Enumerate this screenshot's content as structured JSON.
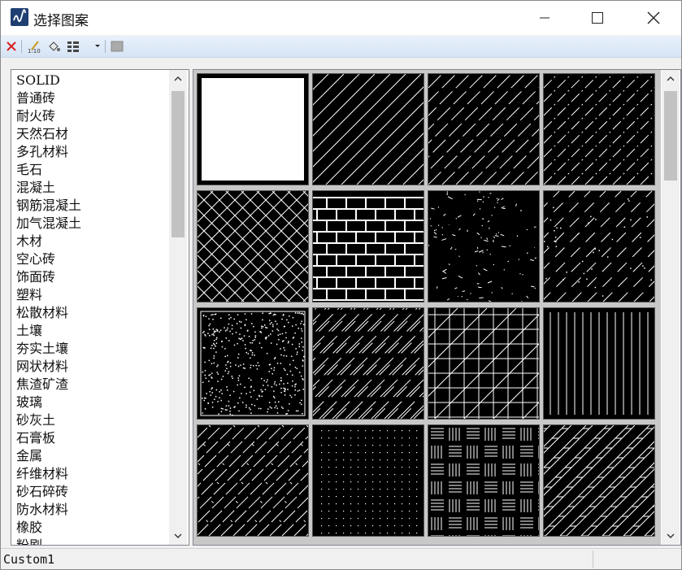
{
  "window": {
    "title": "选择图案"
  },
  "pattern_list": {
    "items": [
      "SOLID",
      "普通砖",
      "耐火砖",
      "天然石材",
      "多孔材料",
      "毛石",
      "混凝土",
      "钢筋混凝土",
      "加气混凝土",
      "木材",
      "空心砖",
      "饰面砖",
      "塑料",
      "松散材料",
      "土壤",
      "夯实土壤",
      "网状材料",
      "焦渣矿渣",
      "玻璃",
      "砂灰土",
      "石膏板",
      "金属",
      "纤维材料",
      "砂石碎砖",
      "防水材料",
      "橡胶",
      "粉刷"
    ]
  },
  "patterns": {
    "tiles": [
      {
        "name": "solid",
        "pattern": "solid"
      },
      {
        "name": "diag-sparse",
        "pattern": "diag-sparse"
      },
      {
        "name": "diag-dashed",
        "pattern": "diag-dashed"
      },
      {
        "name": "diag-dashdot",
        "pattern": "diag-dashdot"
      },
      {
        "name": "crosshatch",
        "pattern": "crosshatch"
      },
      {
        "name": "brick-grid",
        "pattern": "brick"
      },
      {
        "name": "stone-speckle",
        "pattern": "speckle"
      },
      {
        "name": "diag-speckle",
        "pattern": "diag-speckle"
      },
      {
        "name": "dense-dots",
        "pattern": "dense-dots"
      },
      {
        "name": "diag-pairs",
        "pattern": "diag-pairs"
      },
      {
        "name": "grid-diag",
        "pattern": "grid-diag"
      },
      {
        "name": "vertical-lines",
        "pattern": "vertical"
      },
      {
        "name": "diag-segmented",
        "pattern": "diag-seg"
      },
      {
        "name": "dots",
        "pattern": "dots"
      },
      {
        "name": "basket-weave",
        "pattern": "weave"
      },
      {
        "name": "diag-ladder",
        "pattern": "ladder"
      }
    ]
  },
  "status": {
    "text": "Custom1"
  }
}
